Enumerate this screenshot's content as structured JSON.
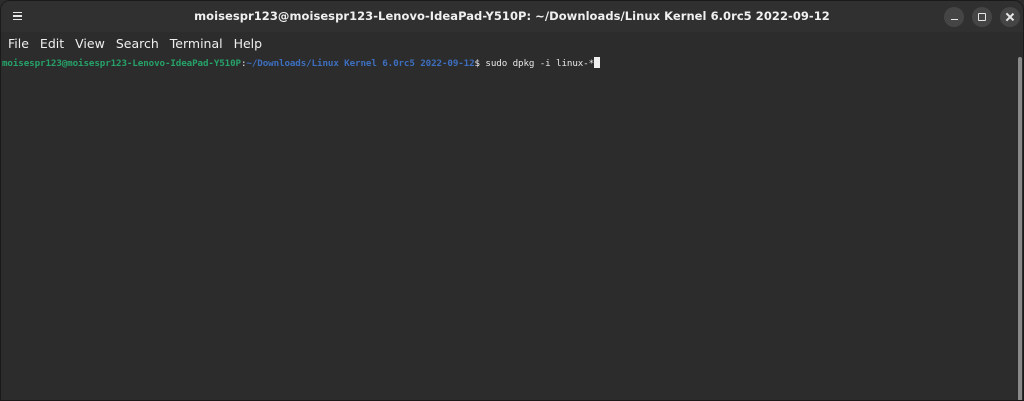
{
  "window": {
    "title": "moisespr123@moisespr123-Lenovo-IdeaPad-Y510P: ~/Downloads/Linux Kernel 6.0rc5 2022-09-12",
    "menu_icon": "hamburger-menu-icon",
    "controls": {
      "minimize_icon": "minimize-icon",
      "maximize_icon": "maximize-icon",
      "close_icon": "close-icon"
    }
  },
  "menubar": {
    "items": [
      "File",
      "Edit",
      "View",
      "Search",
      "Terminal",
      "Help"
    ]
  },
  "terminal": {
    "prompt_user": "moisespr123@moisespr123-Lenovo-IdeaPad-Y510P",
    "prompt_sep": ":",
    "prompt_path": "~/Downloads/Linux Kernel 6.0rc5 2022-09-12",
    "prompt_symbol": "$ ",
    "command": "sudo dpkg -i linux-*"
  },
  "colors": {
    "background": "#2c2c2c",
    "titlebar": "#303030",
    "prompt_user": "#26a269",
    "prompt_path": "#3d6fbf",
    "text": "#e8e8e8"
  }
}
